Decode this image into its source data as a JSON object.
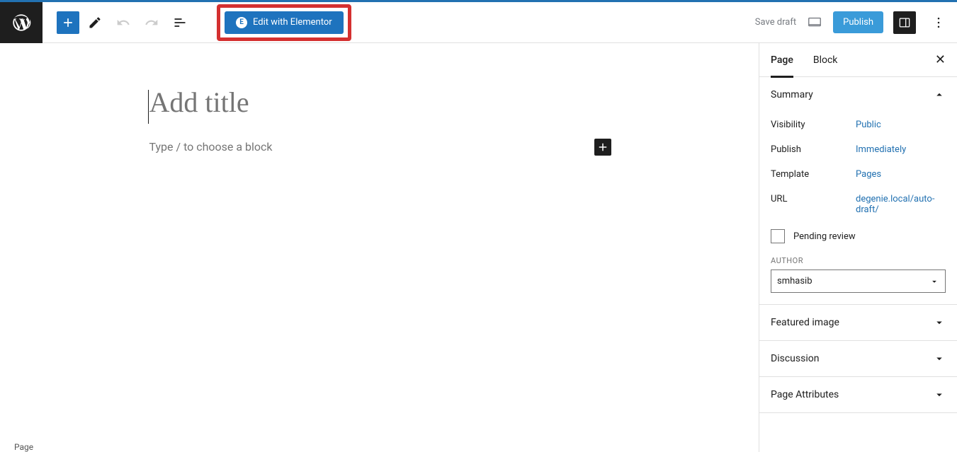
{
  "toolbar": {
    "elementor_label": "Edit with Elementor",
    "save_draft": "Save draft",
    "publish": "Publish"
  },
  "editor": {
    "title_placeholder": "Add title",
    "content_placeholder": "Type / to choose a block"
  },
  "sidebar": {
    "tabs": {
      "page": "Page",
      "block": "Block"
    },
    "summary": {
      "heading": "Summary",
      "visibility_label": "Visibility",
      "visibility_value": "Public",
      "publish_label": "Publish",
      "publish_value": "Immediately",
      "template_label": "Template",
      "template_value": "Pages",
      "url_label": "URL",
      "url_value": "degenie.local/auto-draft/",
      "pending_review": "Pending review",
      "author_label": "AUTHOR",
      "author_value": "smhasib"
    },
    "featured_image": "Featured image",
    "discussion": "Discussion",
    "page_attributes": "Page Attributes"
  },
  "footer": "Page"
}
